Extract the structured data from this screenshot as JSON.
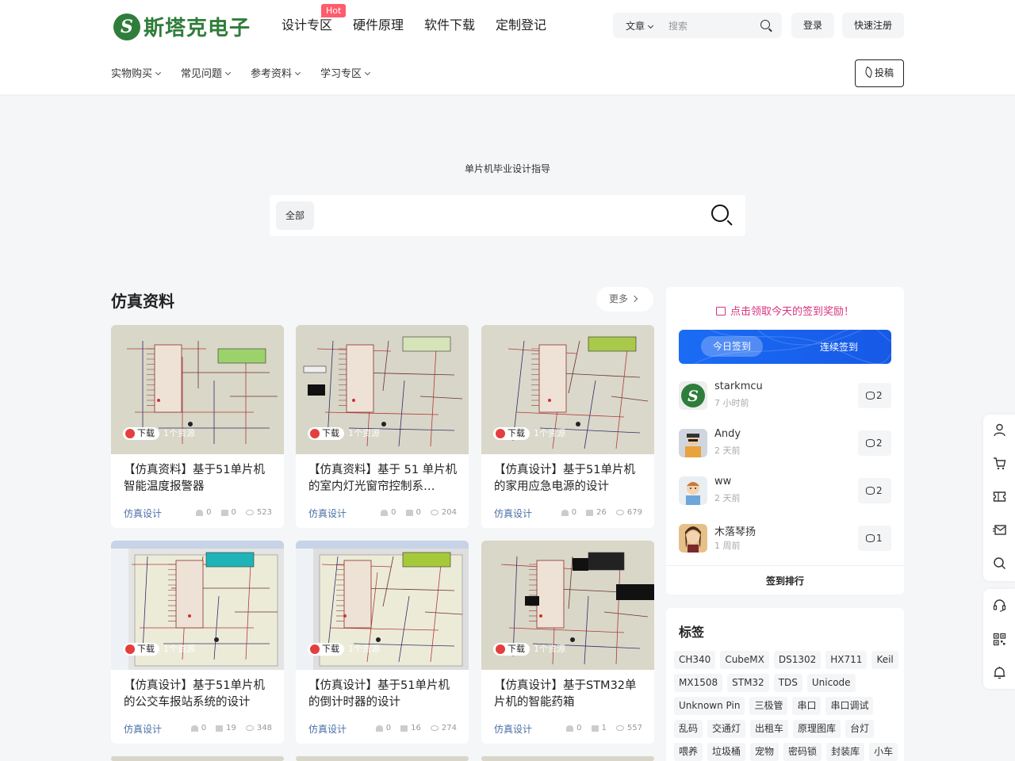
{
  "logo": {
    "text": "斯塔克电子",
    "mark": "S",
    "color": "#2f7d3a"
  },
  "top_nav": [
    {
      "label": "设计专区",
      "badge": "Hot"
    },
    {
      "label": "硬件原理"
    },
    {
      "label": "软件下载"
    },
    {
      "label": "定制登记"
    }
  ],
  "search": {
    "type": "文章",
    "placeholder": "搜索"
  },
  "auth": {
    "login": "登录",
    "register": "快速注册"
  },
  "sub_nav": [
    "实物购买",
    "常见问题",
    "参考资料",
    "学习专区"
  ],
  "post_button": "投稿",
  "hero": {
    "title": "单片机毕业设计指导",
    "scope": "全部"
  },
  "section": {
    "title": "仿真资料",
    "more": "更多"
  },
  "download_label": "下载",
  "resource_label": "1个资源",
  "cards": [
    {
      "title": "【仿真资料】基于51单片机智能温度报警器",
      "category": "仿真设计",
      "likes": "0",
      "comments": "0",
      "views": "523"
    },
    {
      "title": "【仿真资料】基于 51 单片机的室内灯光窗帘控制系…",
      "category": "仿真设计",
      "likes": "0",
      "comments": "0",
      "views": "204"
    },
    {
      "title": "【仿真设计】基于51单片机的家用应急电源的设计",
      "category": "仿真设计",
      "likes": "0",
      "comments": "26",
      "views": "679"
    },
    {
      "title": "【仿真设计】基于51单片机的公交车报站系统的设计",
      "category": "仿真设计",
      "likes": "0",
      "comments": "19",
      "views": "348"
    },
    {
      "title": "【仿真设计】基于51单片机的倒计时器的设计",
      "category": "仿真设计",
      "likes": "0",
      "comments": "16",
      "views": "274"
    },
    {
      "title": "【仿真设计】基于STM32单片机的智能药箱",
      "category": "仿真设计",
      "likes": "0",
      "comments": "1",
      "views": "557"
    }
  ],
  "sign": {
    "header": "点击领取今天的签到奖励！",
    "today": "今日签到",
    "continuous": "连续签到",
    "users": [
      {
        "name": "starkmcu",
        "time": "7 小时前",
        "coins": "2"
      },
      {
        "name": "Andy",
        "time": "2 天前",
        "coins": "2"
      },
      {
        "name": "ww",
        "time": "2 天前",
        "coins": "2"
      },
      {
        "name": "木落琴扬",
        "time": "1 周前",
        "coins": "1"
      }
    ],
    "rank": "签到排行"
  },
  "tags": {
    "title": "标签",
    "items": [
      "CH340",
      "CubeMX",
      "DS1302",
      "HX711",
      "Keil",
      "MX1508",
      "STM32",
      "TDS",
      "Unicode",
      "Unknown Pin",
      "三极管",
      "串口",
      "串口调试",
      "乱码",
      "交通灯",
      "出租车",
      "原理图库",
      "台灯",
      "喂养",
      "垃圾桶",
      "宠物",
      "密码锁",
      "封装库",
      "小车"
    ]
  },
  "float_icons": [
    "user-icon",
    "cart-icon",
    "ticket-icon",
    "message-icon",
    "search-icon",
    "headset-icon",
    "qrcode-icon",
    "bell-icon"
  ]
}
